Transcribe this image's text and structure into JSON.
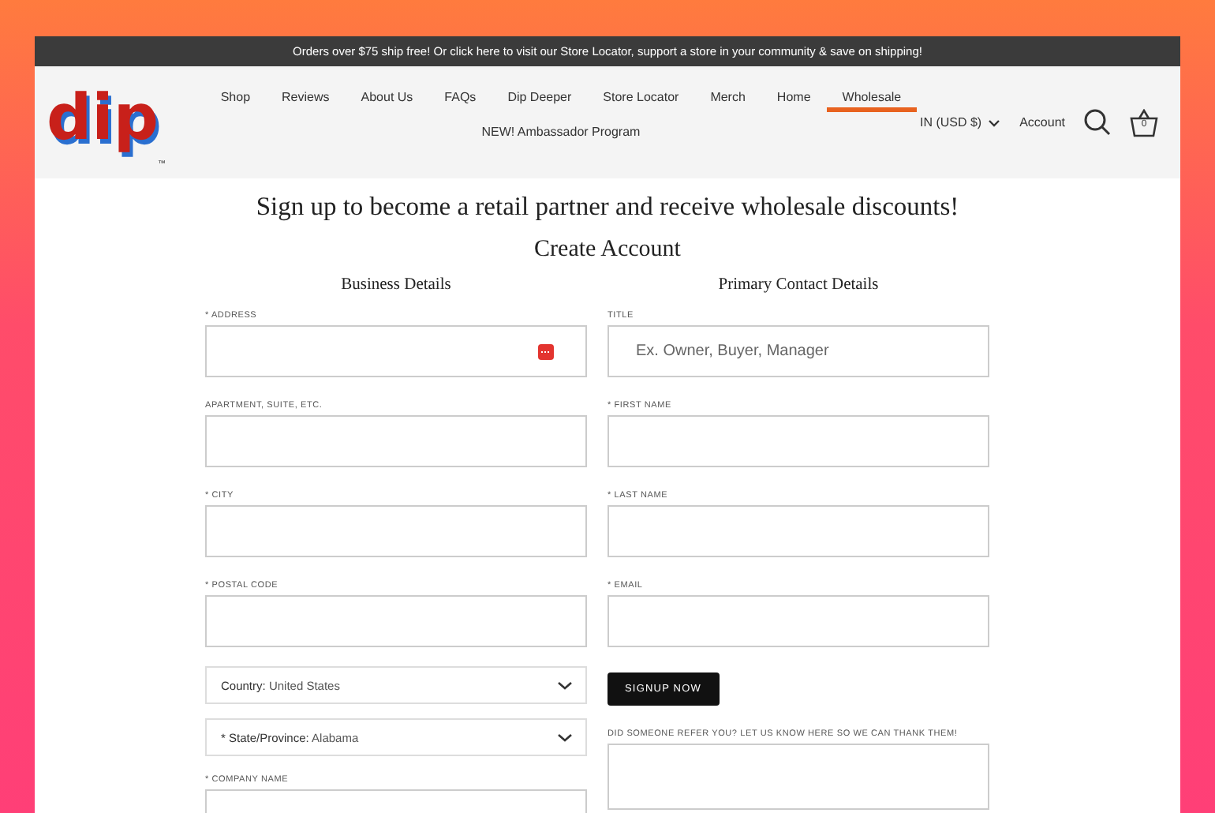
{
  "announcement": "Orders over $75 ship free! Or click here to visit our Store Locator, support a store in your community & save on shipping!",
  "logo": {
    "text": "dip",
    "mark": "™"
  },
  "nav": [
    {
      "label": "Shop",
      "selected": false
    },
    {
      "label": "Reviews",
      "selected": false
    },
    {
      "label": "About Us",
      "selected": false
    },
    {
      "label": "FAQs",
      "selected": false
    },
    {
      "label": "Dip Deeper",
      "selected": false
    },
    {
      "label": "Store Locator",
      "selected": false
    },
    {
      "label": "Merch",
      "selected": false
    },
    {
      "label": "Home",
      "selected": false
    },
    {
      "label": "Wholesale",
      "selected": true
    },
    {
      "label": "NEW! Ambassador Program",
      "selected": false
    }
  ],
  "currency": "IN (USD $)",
  "account": "Account",
  "cart_count": "0",
  "headline": "Sign up to become a retail partner and receive wholesale discounts!",
  "form_title": "Create Account",
  "columns": [
    {
      "heading": "Business Details",
      "fields": [
        {
          "kind": "text",
          "label": "* ADDRESS",
          "autofill_icon": true
        },
        {
          "kind": "text",
          "label": "APARTMENT, SUITE, ETC."
        },
        {
          "kind": "text",
          "label": "* CITY"
        },
        {
          "kind": "text",
          "label": "* POSTAL CODE"
        },
        {
          "kind": "select",
          "label": "Country:",
          "value": "United States"
        },
        {
          "kind": "select",
          "label": "* State/Province:",
          "value": "Alabama"
        },
        {
          "kind": "text",
          "label": "* COMPANY NAME"
        }
      ]
    },
    {
      "heading": "Primary Contact Details",
      "fields": [
        {
          "kind": "text",
          "label": "TITLE",
          "placeholder": "Ex. Owner, Buyer, Manager"
        },
        {
          "kind": "text",
          "label": "* FIRST NAME"
        },
        {
          "kind": "text",
          "label": "* LAST NAME"
        },
        {
          "kind": "text",
          "label": "* EMAIL"
        },
        {
          "kind": "button",
          "label": "SIGNUP NOW"
        },
        {
          "kind": "textarea",
          "label": "DID SOMEONE REFER YOU? LET US KNOW HERE SO WE CAN THANK THEM!"
        }
      ]
    }
  ]
}
